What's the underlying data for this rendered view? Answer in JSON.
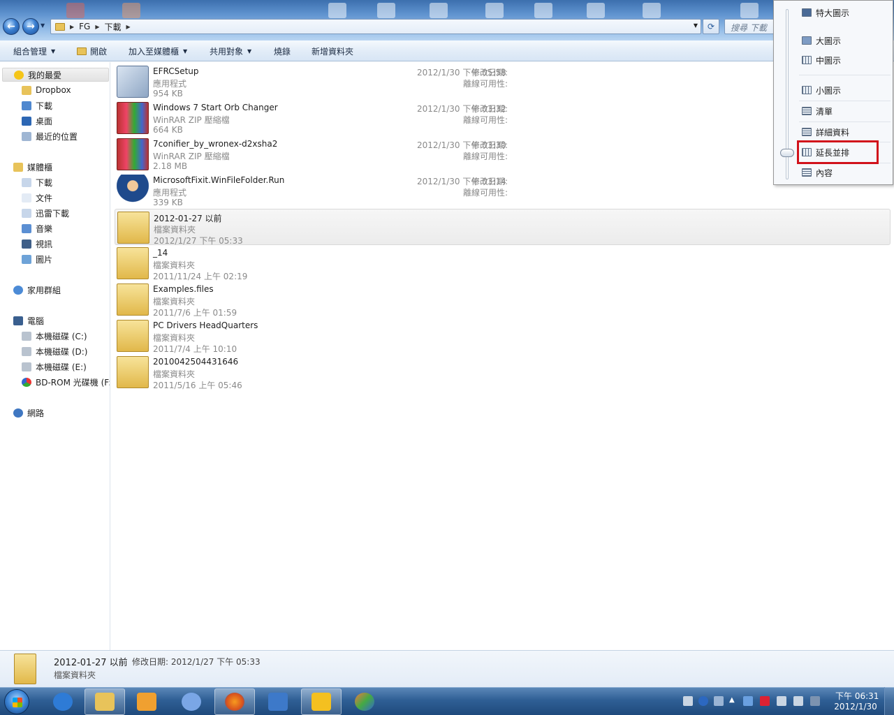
{
  "address": {
    "crumbs": [
      "FG",
      "下載"
    ],
    "search_placeholder": "搜尋 下載"
  },
  "toolbar": {
    "organize": "組合管理",
    "open": "開啟",
    "add_to_library": "加入至媒體櫃",
    "share_with": "共用對象",
    "burn": "燒錄",
    "new_folder": "新增資料夾"
  },
  "nav": {
    "favorites": "我的最愛",
    "dropbox": "Dropbox",
    "downloads": "下載",
    "desktop": "桌面",
    "recent": "最近的位置",
    "libraries": "媒體櫃",
    "lib_downloads": "下載",
    "documents": "文件",
    "thunder": "迅雷下載",
    "music": "音樂",
    "videos": "視訊",
    "pictures": "圖片",
    "homegroup": "家用群組",
    "computer": "電腦",
    "drive_c": "本機磁碟 (C:)",
    "drive_d": "本機磁碟 (D:)",
    "drive_e": "本機磁碟 (E:)",
    "bd_rom": "BD-ROM 光碟機 (F:",
    "network": "網路"
  },
  "files": [
    {
      "name": "EFRCSetup",
      "type": "應用程式",
      "info": "954 KB",
      "mod_label": "修改日期:",
      "mod_value": "2012/1/30 下午 05:58",
      "offline_label": "離線可用性:",
      "icon": "exe-icon"
    },
    {
      "name": "Windows 7 Start Orb Changer",
      "type": "WinRAR ZIP 壓縮檔",
      "info": "664 KB",
      "mod_label": "修改日期:",
      "mod_value": "2012/1/30 下午 03:32",
      "offline_label": "離線可用性:",
      "icon": "rar-icon"
    },
    {
      "name": "7conifier_by_wronex-d2xsha2",
      "type": "WinRAR ZIP 壓縮檔",
      "info": "2.18 MB",
      "mod_label": "修改日期:",
      "mod_value": "2012/1/30 下午 03:30",
      "offline_label": "離線可用性:",
      "icon": "rar-icon"
    },
    {
      "name": "MicrosoftFixit.WinFileFolder.Run",
      "type": "應用程式",
      "info": "339 KB",
      "mod_label": "修改日期:",
      "mod_value": "2012/1/30 下午 03:14",
      "offline_label": "離線可用性:",
      "icon": "fixit-icon"
    },
    {
      "name": "2012-01-27 以前",
      "type": "檔案資料夾",
      "info": "2012/1/27 下午 05:33",
      "icon": "folder-icon"
    },
    {
      "name": "_14",
      "type": "檔案資料夾",
      "info": "2011/11/24 上午 02:19",
      "icon": "folder-icon"
    },
    {
      "name": "Examples.files",
      "type": "檔案資料夾",
      "info": "2011/7/6 上午 01:59",
      "icon": "folder-icon"
    },
    {
      "name": "PC Drivers HeadQuarters",
      "type": "檔案資料夾",
      "info": "2011/7/4 上午 10:10",
      "icon": "folder-icon"
    },
    {
      "name": "2010042504431646",
      "type": "檔案資料夾",
      "info": "2011/5/16 上午 05:46",
      "icon": "folder-icon"
    }
  ],
  "details": {
    "name": "2012-01-27 以前",
    "modified": "修改日期: 2012/1/27 下午 05:33",
    "type": "檔案資料夾"
  },
  "view_menu": {
    "extra_large": "特大圖示",
    "large": "大圖示",
    "medium": "中圖示",
    "small": "小圖示",
    "list": "清單",
    "details": "詳細資料",
    "tiles": "延長並排",
    "content": "內容"
  },
  "clock": {
    "time": "下午 06:31",
    "date": "2012/1/30"
  },
  "colors": {
    "highlight": "#d1121b",
    "accent": "#3b7fd0"
  }
}
